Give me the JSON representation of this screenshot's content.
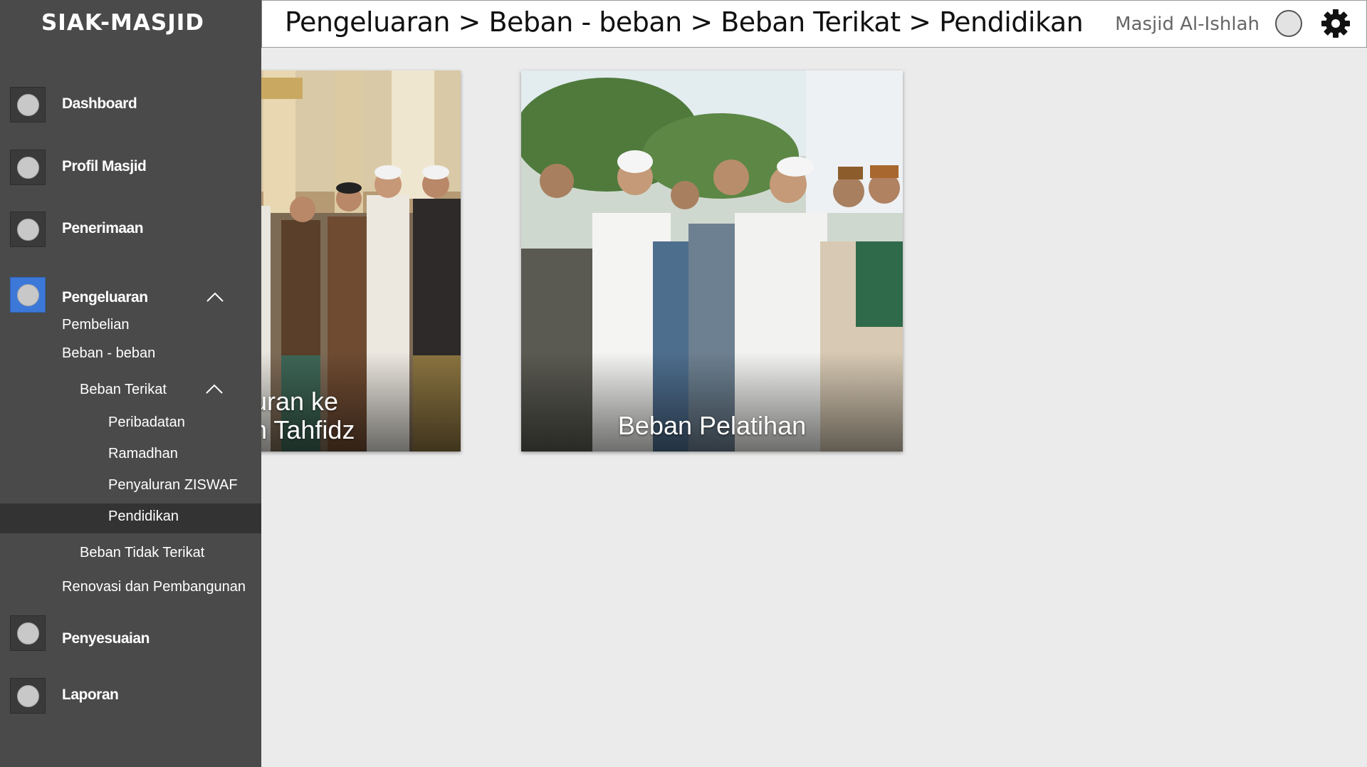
{
  "app": {
    "brand": "SIAK-MASJID"
  },
  "header": {
    "breadcrumb": "Pengeluaran > Beban - beban > Beban Terikat > Pendidikan",
    "mosque_name": "Masjid Al-Ishlah",
    "settings_icon": "gear-icon"
  },
  "sidebar": {
    "items": [
      {
        "label": "Dashboard"
      },
      {
        "label": "Profil Masjid"
      },
      {
        "label": "Penerimaan"
      },
      {
        "label": "Pengeluaran"
      },
      {
        "label": "Penyesuaian"
      },
      {
        "label": "Laporan"
      }
    ],
    "pengeluaran_sub": {
      "pembelian": "Pembelian",
      "beban": "Beban - beban",
      "beban_terikat": "Beban Terikat",
      "beban_terikat_items": [
        "Peribadatan",
        "Ramadhan",
        "Penyaluran ZISWAF",
        "Pendidikan"
      ],
      "beban_tidak_terikat": "Beban Tidak Terikat",
      "renovasi": "Renovasi dan Pembangunan"
    },
    "active_item": "Pendidikan",
    "active_color": "#3c78d8"
  },
  "cards": [
    {
      "caption_line1": "uran ke",
      "caption_line2": "n Tahfidz"
    },
    {
      "caption": "Beban Pelatihan"
    }
  ]
}
